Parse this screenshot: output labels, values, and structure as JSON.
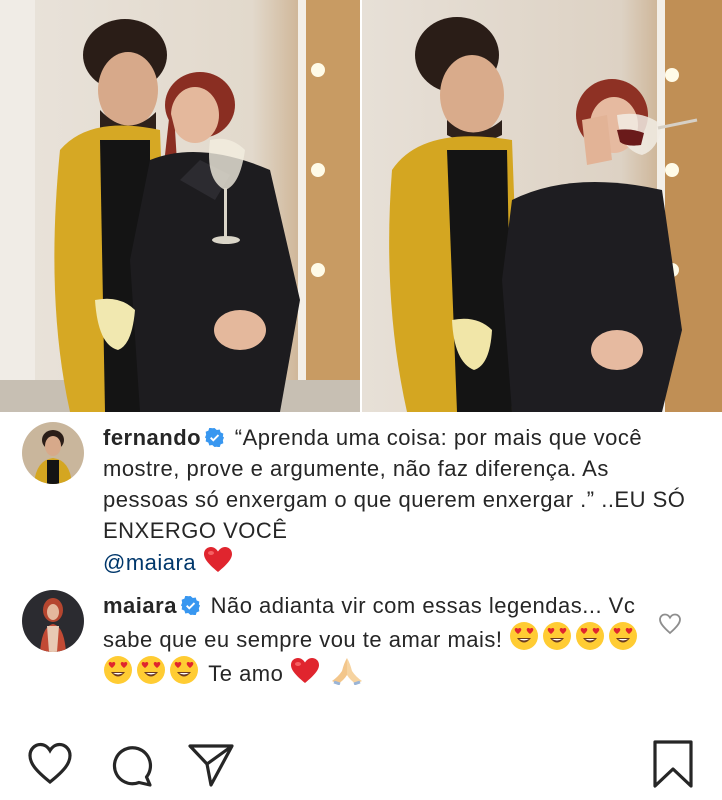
{
  "photos": [
    {
      "name": "photo-left",
      "alt": ""
    },
    {
      "name": "photo-right",
      "alt": ""
    }
  ],
  "comments": [
    {
      "username": "fernando",
      "text": "“Aprenda uma coisa: por mais que você mostre, prove e argumente, não faz diferença. As pessoas só enxergam o que querem enxergar .” ..EU SÓ ENXERGO VOCÊ",
      "mention": "@maiara",
      "verified": true
    },
    {
      "username": "maiara",
      "text_start": "Não adianta vir com essas legendas... Vc sabe que eu sempre vou te amar mais!",
      "text_end": "Te amo",
      "emoji_count": 7,
      "verified": true
    }
  ],
  "colors": {
    "verified": "#3897f0",
    "heart": "#e0252e",
    "text": "#262626"
  },
  "icons": [
    "heart-outline-icon",
    "comment-icon",
    "share-icon",
    "bookmark-icon"
  ]
}
